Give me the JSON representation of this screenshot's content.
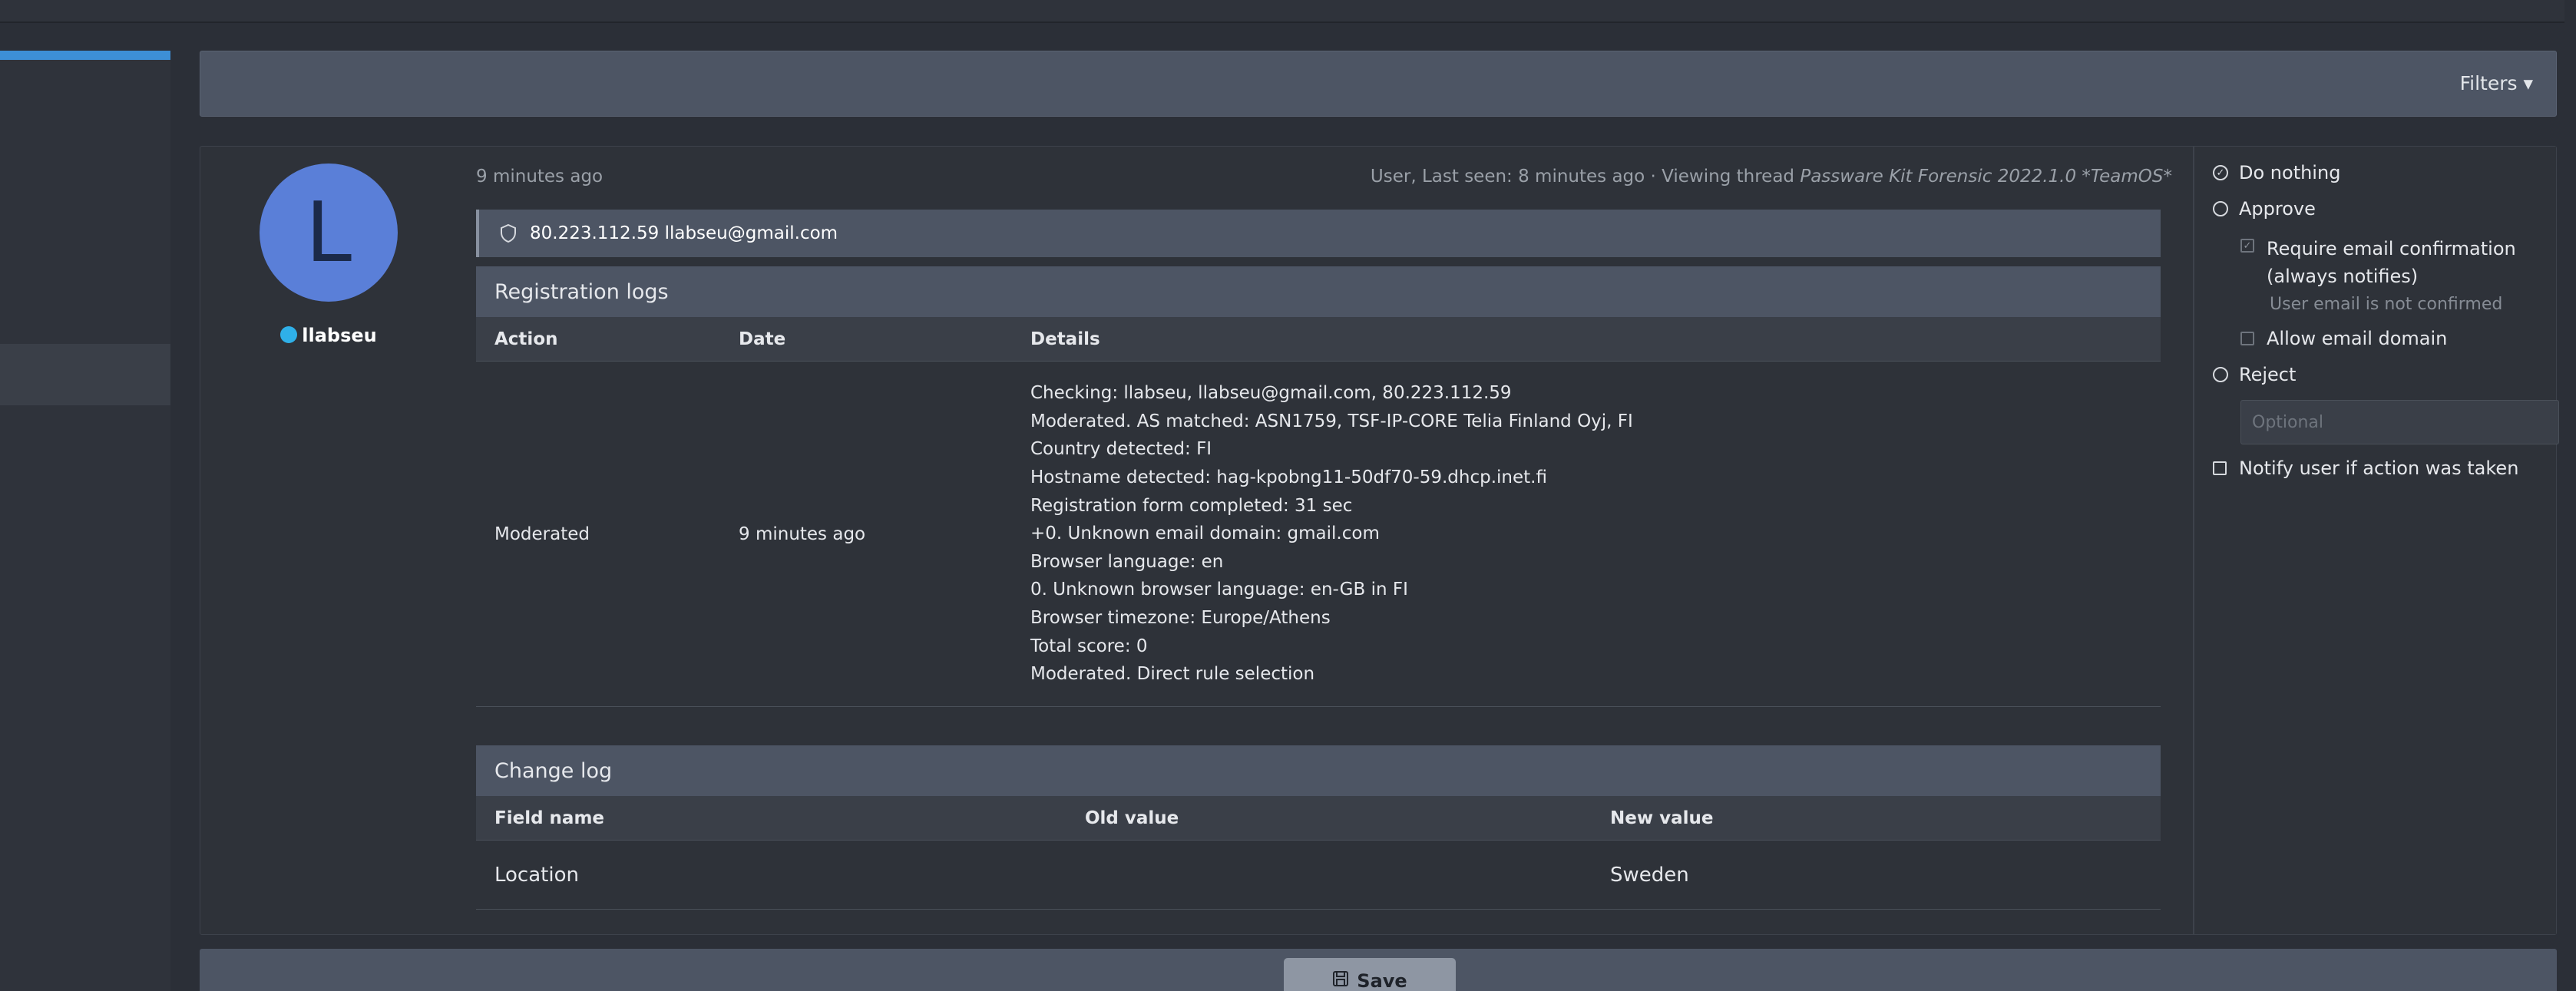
{
  "filters": {
    "label": "Filters ▾"
  },
  "user": {
    "avatar_letter": "L",
    "name": "llabseu",
    "time_ago": "9 minutes ago",
    "last_seen_prefix": "User, Last seen: 8 minutes ago · Viewing thread ",
    "viewing_thread": "Passware Kit Forensic 2022.1.0 *TeamOS*",
    "ip_email": "80.223.112.59 llabseu@gmail.com"
  },
  "registration": {
    "title": "Registration logs",
    "headers": [
      "Action",
      "Date",
      "Details"
    ],
    "row": {
      "action": "Moderated",
      "date": "9 minutes ago",
      "details": [
        "Checking: llabseu, llabseu@gmail.com, 80.223.112.59",
        "Moderated. AS matched: ASN1759, TSF-IP-CORE Telia Finland Oyj, FI",
        "Country detected: FI",
        "Hostname detected: hag-kpobng11-50df70-59.dhcp.inet.fi",
        "Registration form completed: 31 sec",
        "+0. Unknown email domain: gmail.com",
        "Browser language: en",
        "0. Unknown browser language: en-GB in FI",
        "Browser timezone: Europe/Athens",
        "Total score: 0",
        "Moderated. Direct rule selection"
      ]
    }
  },
  "changelog": {
    "title": "Change log",
    "headers": [
      "Field name",
      "Old value",
      "New value"
    ],
    "row": {
      "field": "Location",
      "old": "",
      "new": "Sweden"
    }
  },
  "actions": {
    "do_nothing": "Do nothing",
    "approve": "Approve",
    "require_email": "Require email confirmation",
    "require_email_2": "(always notifies)",
    "email_hint": "User email is not confirmed",
    "allow_domain": "Allow email domain",
    "reject": "Reject",
    "reject_placeholder": "Optional",
    "notify": "Notify user if action was taken"
  },
  "save": {
    "label": "Save"
  }
}
